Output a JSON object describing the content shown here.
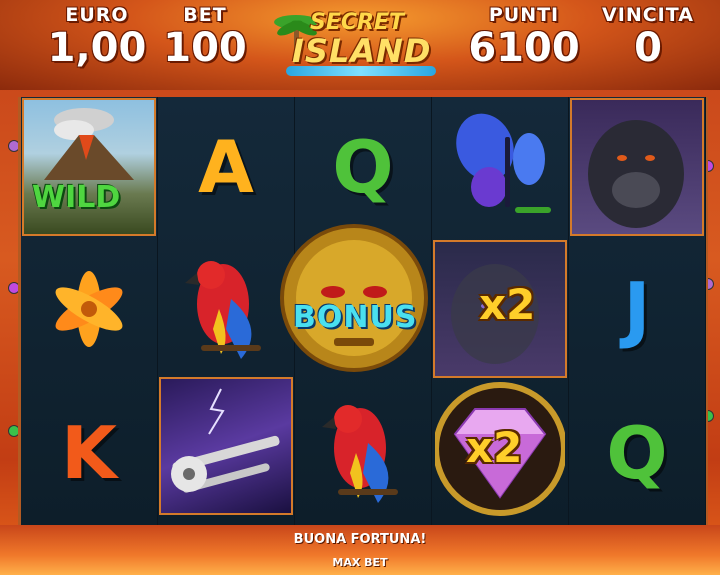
{
  "header": {
    "euro_label": "EURO",
    "euro_value": "1,00",
    "bet_label": "BET",
    "bet_value": "100",
    "points_label": "PUNTI",
    "points_value": "6100",
    "win_label": "VINCITA",
    "win_value": "0"
  },
  "logo": {
    "line1": "SECRET",
    "line2": "ISLAND"
  },
  "symbols": {
    "wild": "WILD",
    "bonus": "BONUS",
    "multiplier": "x2",
    "a": "A",
    "q": "Q",
    "j": "J",
    "k": "K"
  },
  "footer": {
    "message": "BUONA FORTUNA!",
    "max_bet": "MAX BET"
  },
  "colors": {
    "accent": "#ffcf2a",
    "wild": "#4fd640",
    "bonus": "#4ae0f0"
  }
}
